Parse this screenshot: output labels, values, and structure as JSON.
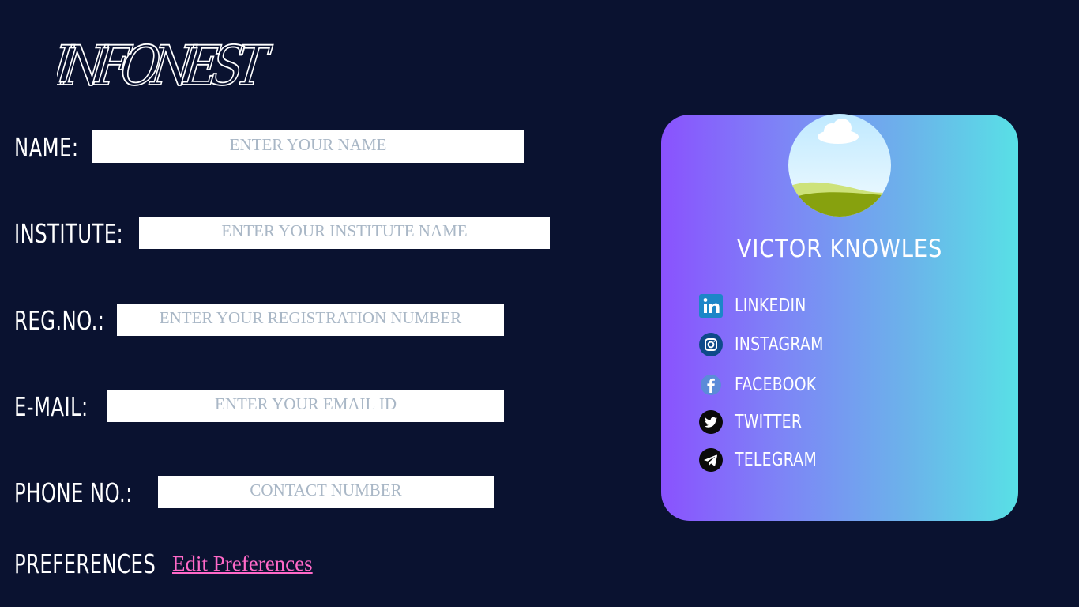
{
  "app": {
    "logo_text": "INFONEST"
  },
  "form": {
    "fields": [
      {
        "label": "NAME:",
        "placeholder": "ENTER YOUR NAME",
        "value": ""
      },
      {
        "label": "INSTITUTE:",
        "placeholder": "ENTER YOUR INSTITUTE NAME",
        "value": ""
      },
      {
        "label": "REG.NO.:",
        "placeholder": "ENTER YOUR REGISTRATION NUMBER",
        "value": ""
      },
      {
        "label": "E-MAIL:",
        "placeholder": "ENTER YOUR EMAIL ID",
        "value": ""
      },
      {
        "label": "PHONE NO.:",
        "placeholder": "CONTACT NUMBER",
        "value": ""
      }
    ],
    "preferences": {
      "label": "PREFERENCES",
      "link_text": "Edit Preferences"
    }
  },
  "profile": {
    "name": "VICTOR KNOWLES",
    "avatar_icon": "landscape-avatar-icon",
    "socials": [
      {
        "label": "LINKEDIN",
        "icon": "linkedin-icon"
      },
      {
        "label": "INSTAGRAM",
        "icon": "instagram-icon"
      },
      {
        "label": "FACEBOOK",
        "icon": "facebook-icon"
      },
      {
        "label": "TWITTER",
        "icon": "twitter-icon"
      },
      {
        "label": "TELEGRAM",
        "icon": "telegram-icon"
      }
    ]
  },
  "colors": {
    "background": "#0a1230",
    "link": "#ff69c8",
    "card_gradient_start": "#8a52fe",
    "card_gradient_end": "#58e0e6"
  }
}
